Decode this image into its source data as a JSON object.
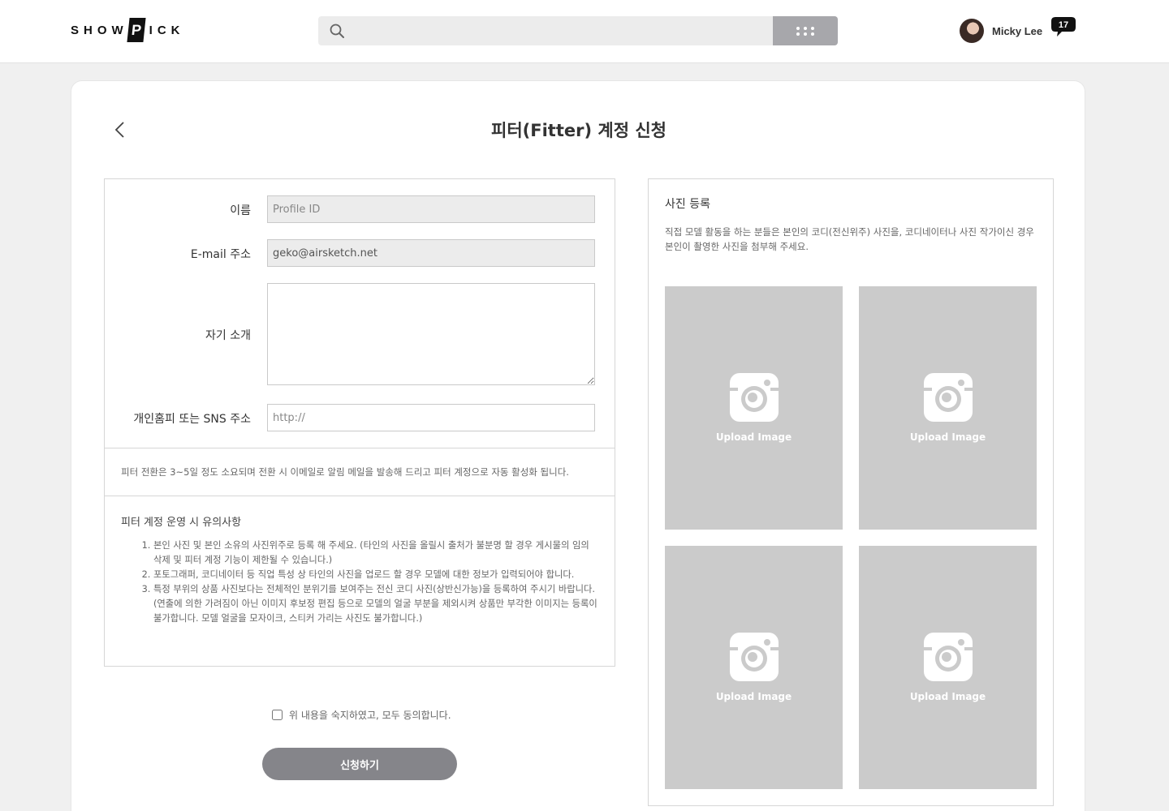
{
  "header": {
    "logo_text": "SHOWPICK",
    "logo_before": "SHOW",
    "logo_p": "P",
    "logo_after": "ICK",
    "search_placeholder": "",
    "user_name": "Micky Lee",
    "notification_count": "17"
  },
  "page": {
    "title": "피터(Fitter) 계정 신청"
  },
  "form": {
    "name_label": "이름",
    "name_placeholder": "Profile ID",
    "email_label": "E-mail 주소",
    "email_value": "geko@airsketch.net",
    "intro_label": "자기 소개",
    "intro_value": "",
    "sns_label": "개인홈피 또는 SNS 주소",
    "sns_placeholder": "http://",
    "notice": "피터 전환은 3~5일 정도 소요되며 전환 시 이메일로 알림 메일을 발송해 드리고 피터 계정으로 자동 활성화 됩니다.",
    "cautions_title": "피터 계정 운영 시 유의사항",
    "cautions": [
      "본인 사진 및 본인 소유의 사진위주로 등록 해 주세요. (타인의 사진을 올릴시 출처가 불분명 할 경우 게시물의 임의 삭제 및 피터 계정 기능이 제한될 수 있습니다.)",
      "포토그래퍼, 코디네이터 등 직업 특성 상 타인의 사진을 업로드 할 경우 모델에 대한 정보가 입력되어야 합니다.",
      "특정 부위의 상품 사진보다는 전체적인 분위기를 보여주는 전신 코디 사진(상반신가능)을 등록하여 주시기 바랍니다. (연출에 의한 가려짐이 아닌 이미지 후보정 편집 등으로 모델의 얼굴 부분을 제외시켜 상품만 부각한 이미지는 등록이 불가합니다. 모델 얼굴을 모자이크, 스티커 가리는 사진도 불가합니다.)"
    ],
    "agree_label": "위 내용을 숙지하였고, 모두 동의합니다.",
    "agree_checked": false,
    "submit_label": "신청하기"
  },
  "photos": {
    "title": "사진 등록",
    "description": "직접 모델 활동을 하는 분들은 본인의 코디(전신위주) 사진을, 코디네이터나 사진 작가이신 경우 본인이 촬영한 사진을 첨부해 주세요.",
    "tiles": [
      {
        "label": "Upload Image",
        "icon": "camera-icon"
      },
      {
        "label": "Upload Image",
        "icon": "camera-icon"
      },
      {
        "label": "Upload Image",
        "icon": "camera-icon"
      },
      {
        "label": "Upload Image",
        "icon": "camera-icon"
      }
    ]
  },
  "colors": {
    "grid_button": "#a7a7ab",
    "submit_button": "#85858a",
    "tile_bg": "#cbcbcb"
  }
}
